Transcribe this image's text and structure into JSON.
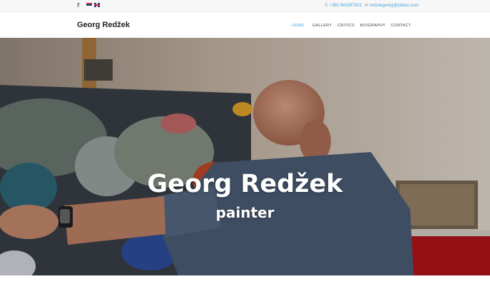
{
  "topbar": {
    "social_icon_label": "f",
    "phone": "+381 641987921",
    "email": "redzekgeorg@yahoo.com"
  },
  "header": {
    "logo": "Georg Redžek",
    "nav": [
      {
        "label": "HOME",
        "active": true
      },
      {
        "label": "GALLERY",
        "active": false
      },
      {
        "label": "CRITICS",
        "active": false
      },
      {
        "label": "BIOGRAPHY",
        "active": false
      },
      {
        "label": "CONTACT",
        "active": false
      }
    ]
  },
  "hero": {
    "title": "Georg Redžek",
    "subtitle": "painter"
  },
  "colors": {
    "accent": "#4aa3d6",
    "text": "#222222",
    "topbar_bg": "#f7f7f7"
  },
  "icons": [
    "facebook-icon",
    "serbian-flag-icon",
    "english-flag-icon",
    "phone-icon",
    "email-icon"
  ]
}
